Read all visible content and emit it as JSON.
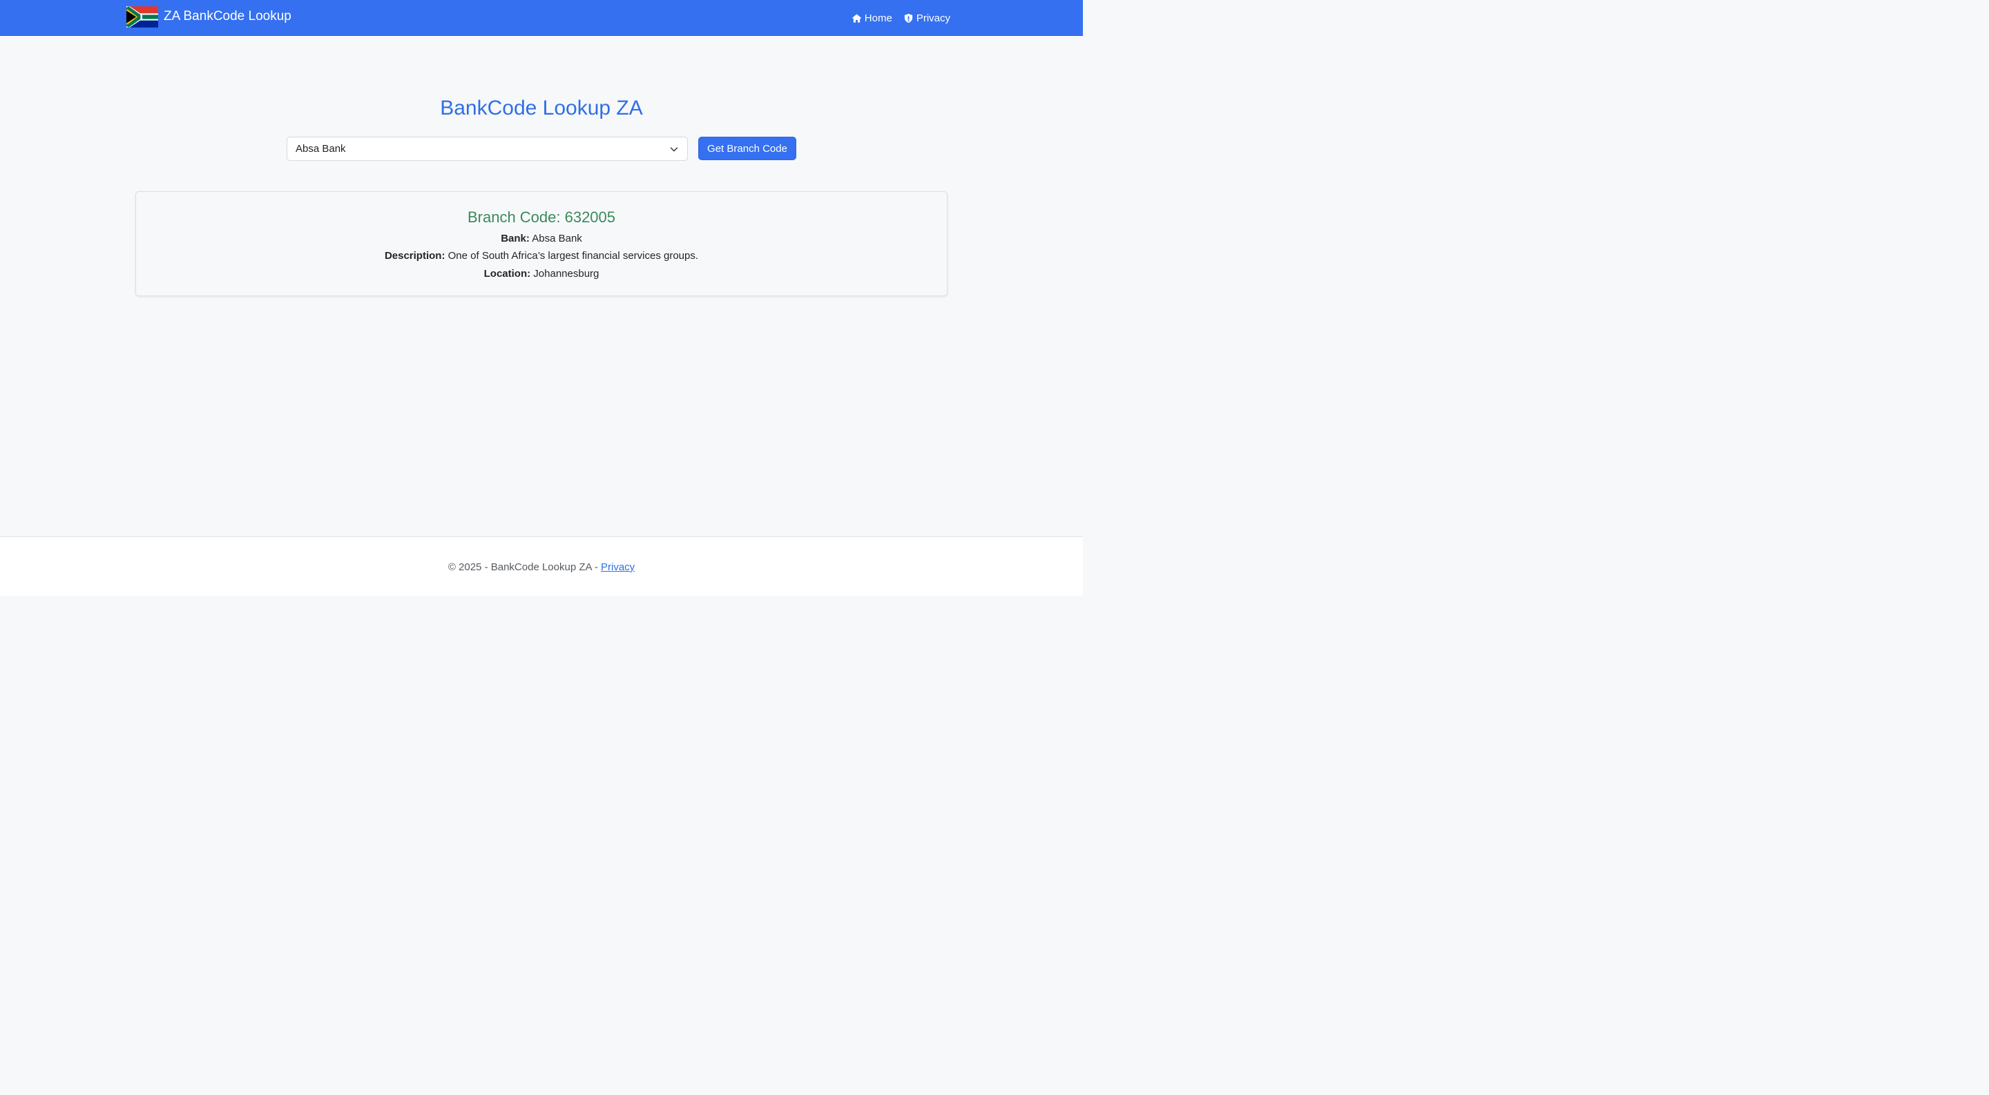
{
  "navbar": {
    "brand": "ZA BankCode Lookup",
    "links": [
      {
        "label": "Home",
        "icon": "home-icon"
      },
      {
        "label": "Privacy",
        "icon": "shield-icon"
      }
    ]
  },
  "main": {
    "title": "BankCode Lookup ZA",
    "bank_select": {
      "selected": "Absa Bank"
    },
    "submit_label": "Get Branch Code"
  },
  "result": {
    "heading": "Branch Code: 632005",
    "bank_label": "Bank:",
    "bank_value": "Absa Bank",
    "description_label": "Description:",
    "description_value": "One of South Africa’s largest financial services groups.",
    "location_label": "Location:",
    "location_value": "Johannesburg"
  },
  "footer": {
    "text": "© 2025 - BankCode Lookup ZA - ",
    "link": "Privacy"
  },
  "colors": {
    "primary": "#3470f0",
    "title": "#2f6fe6",
    "success": "#3a8a5a",
    "background": "#f6f8fa"
  }
}
